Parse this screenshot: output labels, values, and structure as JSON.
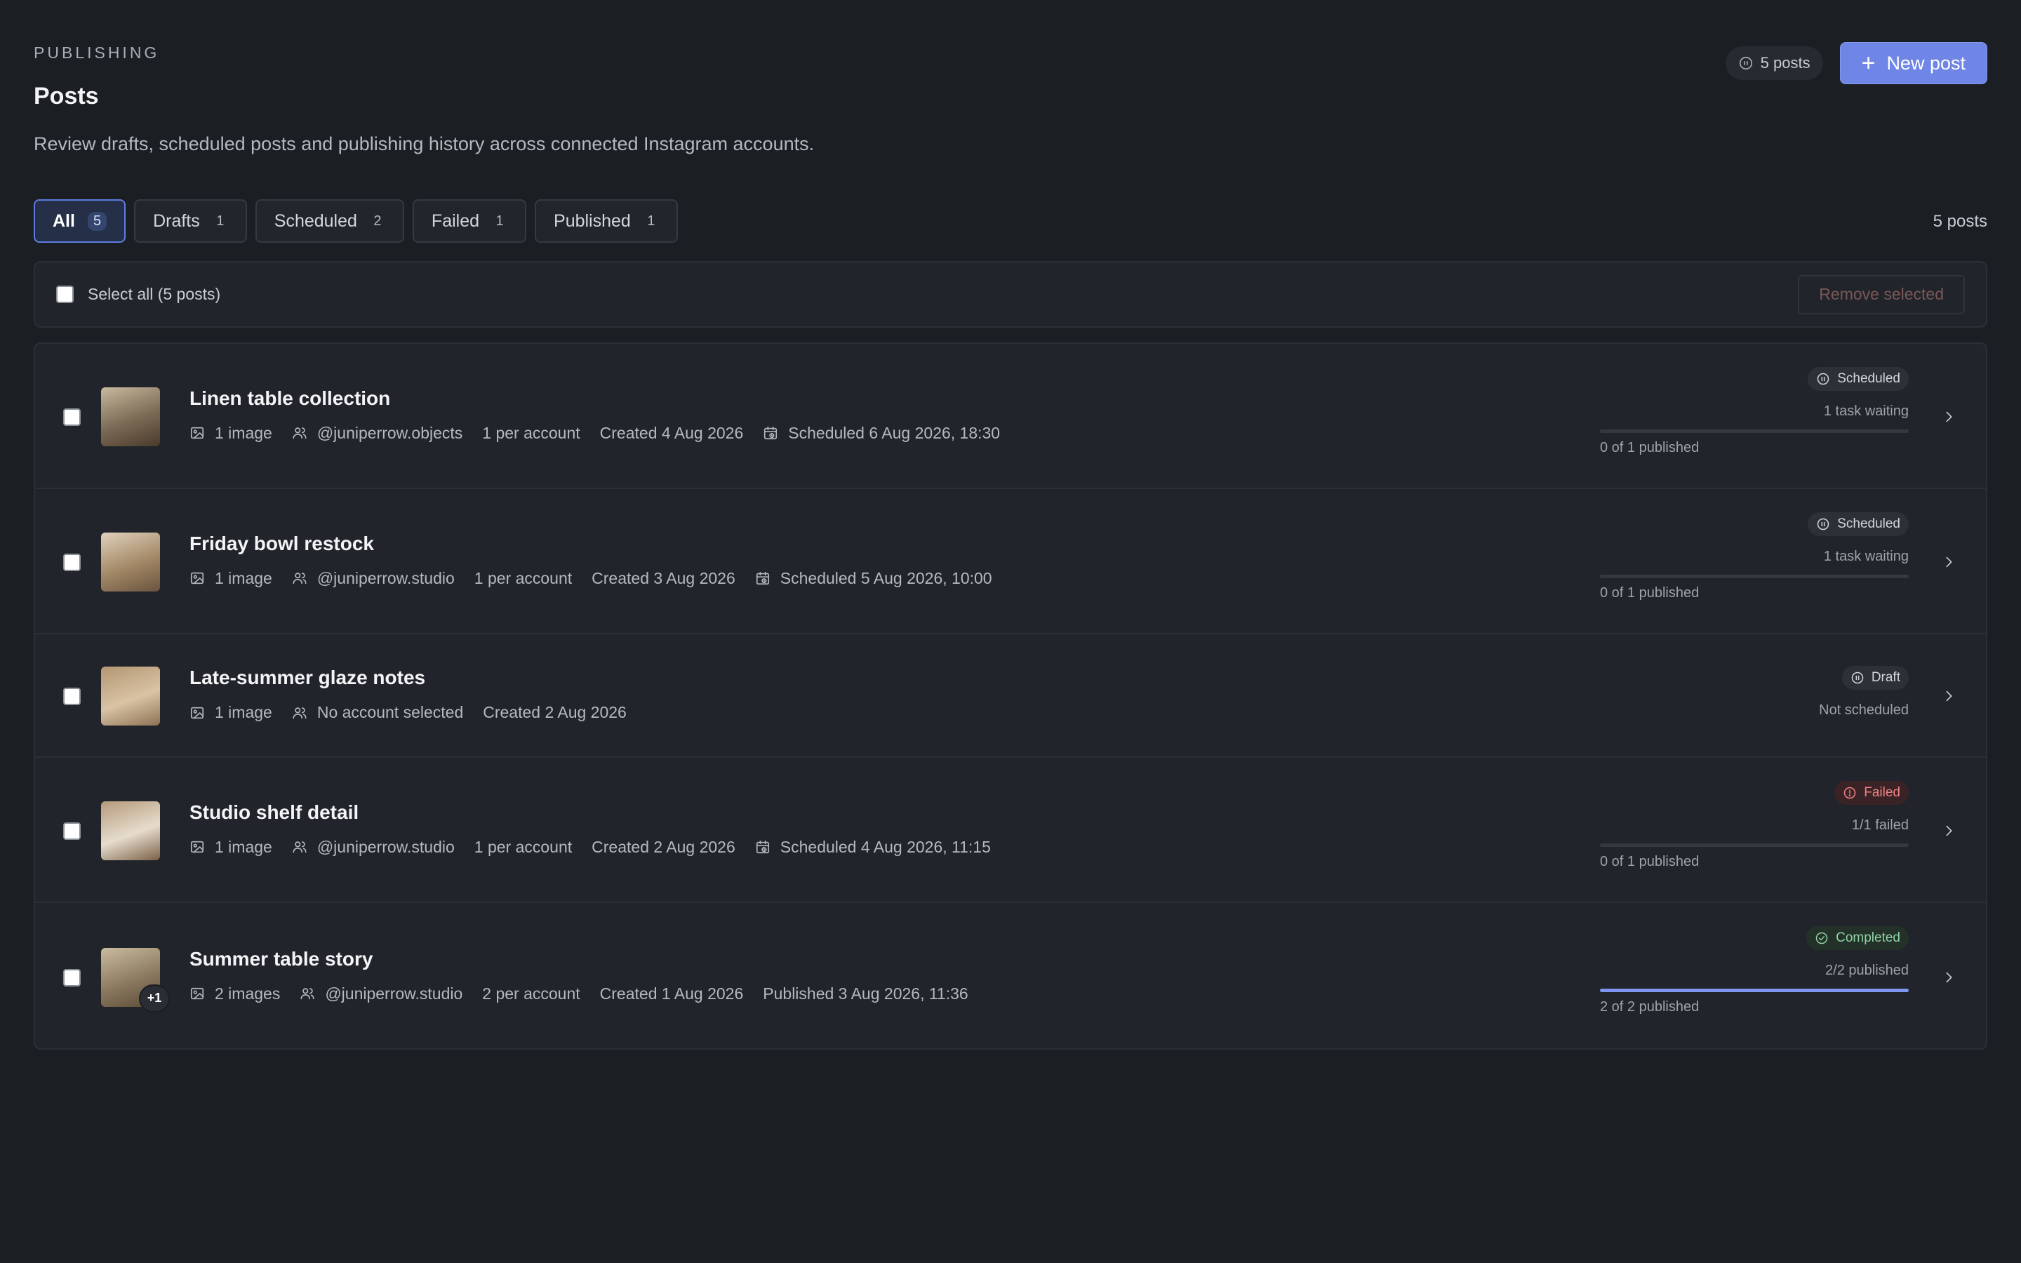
{
  "header": {
    "eyebrow": "PUBLISHING",
    "title": "Posts",
    "description": "Review drafts, scheduled posts and publishing history across connected Instagram accounts.",
    "posts_chip": "5 posts",
    "new_post_label": "New post"
  },
  "tabs": [
    {
      "label": "All",
      "count": "5",
      "active": true
    },
    {
      "label": "Drafts",
      "count": "1",
      "active": false
    },
    {
      "label": "Scheduled",
      "count": "2",
      "active": false
    },
    {
      "label": "Failed",
      "count": "1",
      "active": false
    },
    {
      "label": "Published",
      "count": "1",
      "active": false
    }
  ],
  "posts_count_label": "5 posts",
  "select_bar": {
    "select_all_label": "Select all (5 posts)",
    "remove_selected_label": "Remove selected"
  },
  "posts": [
    {
      "title": "Linen table collection",
      "images": "1 image",
      "account": "@juniperrow.objects",
      "per_account": "1 per account",
      "created": "Created 4 Aug 2026",
      "schedule": "Scheduled 6 Aug 2026, 18:30",
      "status": "Scheduled",
      "status_kind": "scheduled",
      "note": "1 task waiting",
      "progress_fraction": 0,
      "progress_caption": "0 of 1 published",
      "thumb_colors": [
        "#7b6a55",
        "#c9b99f",
        "#4a3a2b"
      ]
    },
    {
      "title": "Friday bowl restock",
      "images": "1 image",
      "account": "@juniperrow.studio",
      "per_account": "1 per account",
      "created": "Created 3 Aug 2026",
      "schedule": "Scheduled 5 Aug 2026, 10:00",
      "status": "Scheduled",
      "status_kind": "scheduled",
      "note": "1 task waiting",
      "progress_fraction": 0,
      "progress_caption": "0 of 1 published",
      "thumb_colors": [
        "#a38866",
        "#e0d2bd",
        "#6a5440"
      ]
    },
    {
      "title": "Late-summer glaze notes",
      "images": "1 image",
      "account": "No account selected",
      "per_account": "",
      "created": "Created 2 Aug 2026",
      "schedule": "",
      "status": "Draft",
      "status_kind": "draft",
      "note": "Not scheduled",
      "progress_fraction": null,
      "progress_caption": "",
      "thumb_colors": [
        "#d8c3a4",
        "#b49673",
        "#8d7254"
      ]
    },
    {
      "title": "Studio shelf detail",
      "images": "1 image",
      "account": "@juniperrow.studio",
      "per_account": "1 per account",
      "created": "Created 2 Aug 2026",
      "schedule": "Scheduled 4 Aug 2026, 11:15",
      "status": "Failed",
      "status_kind": "failed",
      "note": "1/1 failed",
      "progress_fraction": 0,
      "progress_caption": "0 of 1 published",
      "thumb_colors": [
        "#e6dccd",
        "#b59a7a",
        "#7b6148"
      ]
    },
    {
      "title": "Summer table story",
      "images": "2 images",
      "account": "@juniperrow.studio",
      "per_account": "2 per account",
      "created": "Created 1 Aug 2026",
      "schedule": "Published 3 Aug 2026, 11:36",
      "status": "Completed",
      "status_kind": "completed",
      "note": "2/2 published",
      "progress_fraction": 1,
      "progress_caption": "2 of 2 published",
      "extra_badge": "+1",
      "thumb_colors": [
        "#8b7a60",
        "#cbbba0",
        "#5c4a36"
      ]
    }
  ],
  "colors": {
    "background": "#1b1e22",
    "accent": "#6f86e6",
    "failed": "#f08383",
    "completed": "#8fd3a6"
  }
}
